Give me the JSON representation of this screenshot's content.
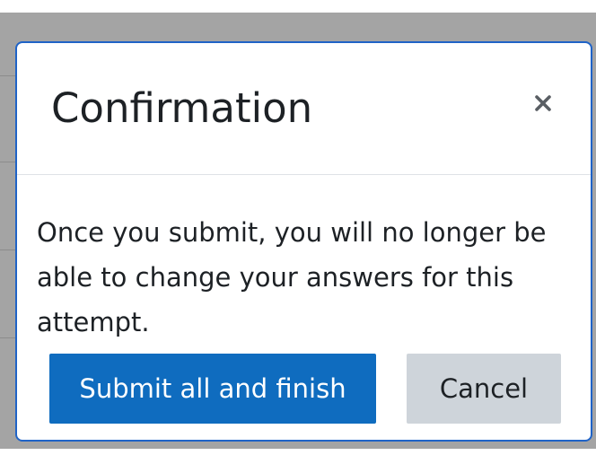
{
  "dialog": {
    "title": "Confirmation",
    "close_icon": "close-icon",
    "message": "Once you submit, you will no longer be able to change your answers for this attempt.",
    "submit_label": "Submit all and finish",
    "cancel_label": "Cancel"
  },
  "colors": {
    "primary": "#0f6cbf",
    "secondary": "#ced4da",
    "modal_border": "#1f63c7",
    "backdrop": "#a4a4a4",
    "text": "#1d2125"
  }
}
